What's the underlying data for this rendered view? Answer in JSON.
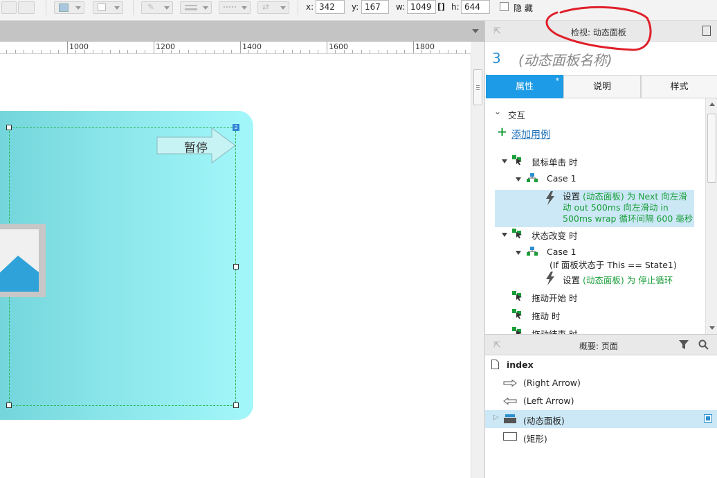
{
  "toolbar": {
    "x_label": "x:",
    "x_value": "342",
    "y_label": "y:",
    "y_value": "167",
    "w_label": "w:",
    "w_value": "1049",
    "h_label": "h:",
    "h_value": "644",
    "hide_label": "隐 藏"
  },
  "ruler": {
    "labels": [
      "1000",
      "1200",
      "1400",
      "1600",
      "1800"
    ]
  },
  "canvas": {
    "arrow_button_text": "暂停",
    "badge_text": "2"
  },
  "inspector": {
    "header_title": "检视: 动态面板",
    "item_number": "3",
    "name_placeholder": "(动态面板名称)",
    "tabs": [
      {
        "label": "属性",
        "marker": "*"
      },
      {
        "label": "说明"
      },
      {
        "label": "样式"
      }
    ],
    "section_title": "交互",
    "add_case": "添加用例",
    "events": [
      {
        "name": "鼠标单击 时",
        "case": "Case 1",
        "action_prefix": "设置",
        "action_lines": [
          "(动态面板) 为 Next 向左滑",
          "动 out 500ms 向左滑动 in",
          "500ms wrap 循环间隔 600 毫秒"
        ]
      },
      {
        "name": "状态改变 时",
        "case": "Case 1",
        "condition": "(If 面板状态于 This == State1)",
        "action_prefix": "设置",
        "action_text": "(动态面板) 为 停止循环"
      },
      {
        "name": "拖动开始 时"
      },
      {
        "name": "拖动 时"
      },
      {
        "name": "拖动结束 时"
      }
    ]
  },
  "outline": {
    "title": "概要: 页面",
    "page": "index",
    "items": [
      {
        "label": "(Right Arrow)",
        "icon": "right-arrow-icon"
      },
      {
        "label": "(Left Arrow)",
        "icon": "left-arrow-icon"
      },
      {
        "label": "(动态面板)",
        "icon": "dynamic-panel-icon",
        "selected": true
      },
      {
        "label": "(矩形)",
        "icon": "rectangle-icon"
      }
    ]
  },
  "colors": {
    "accent_blue": "#1e9be6",
    "action_green": "#1a9e3a",
    "selection_bg": "#cce8f6",
    "annotation_red": "#e0202a"
  }
}
